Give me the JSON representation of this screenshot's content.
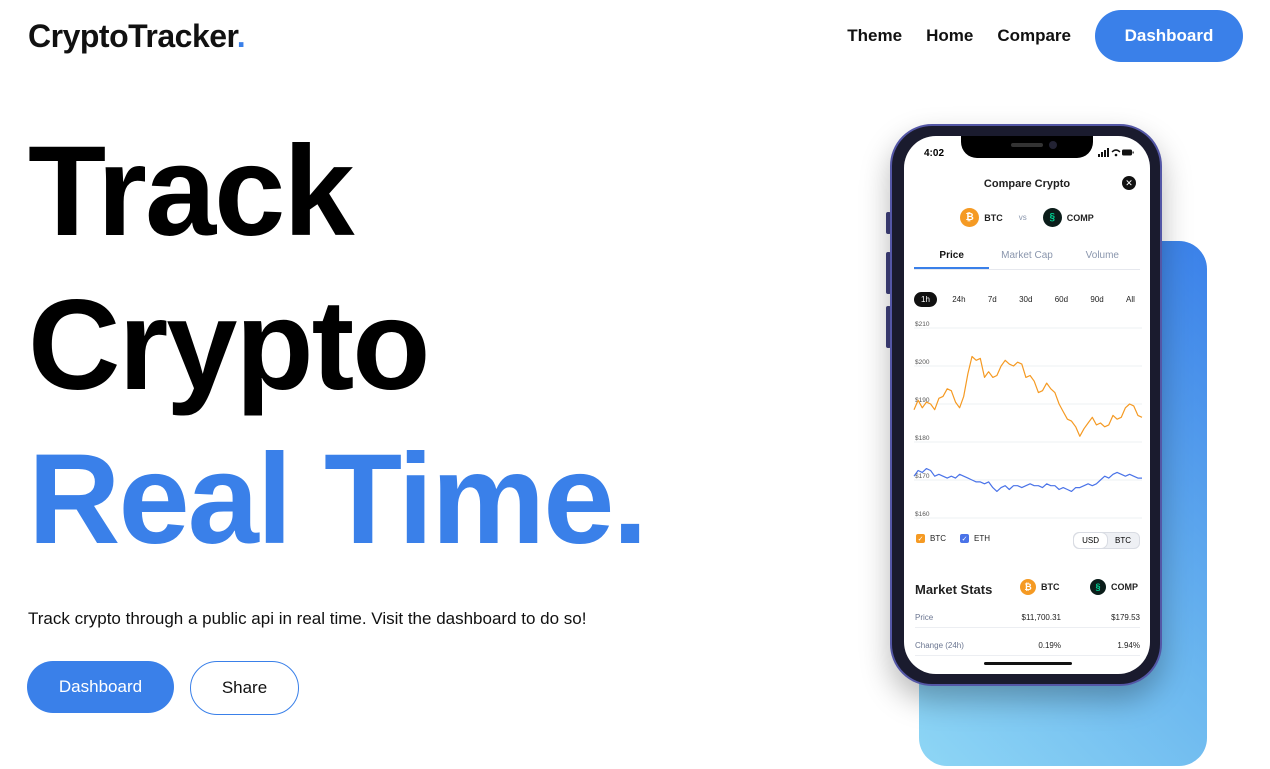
{
  "logo": {
    "text": "CryptoTracker",
    "dot": "."
  },
  "nav": {
    "links": [
      "Theme",
      "Home",
      "Compare"
    ],
    "cta": "Dashboard"
  },
  "hero": {
    "line1": "Track",
    "line2": "Crypto",
    "line3": "Real Time.",
    "subtitle": "Track crypto through a public api in real time. Visit the dashboard to do so!",
    "primary_button": "Dashboard",
    "secondary_button": "Share"
  },
  "colors": {
    "accent": "#3a80e9",
    "btc": "#f59a23",
    "eth_line": "#4a73e8"
  },
  "phone": {
    "time": "4:02",
    "title": "Compare Crypto",
    "coin_a": "BTC",
    "vs": "vs",
    "coin_b": "COMP",
    "tabs": [
      "Price",
      "Market Cap",
      "Volume"
    ],
    "active_tab": "Price",
    "ranges": [
      "1h",
      "24h",
      "7d",
      "30d",
      "60d",
      "90d",
      "All"
    ],
    "active_range": "1h",
    "currency": [
      "USD",
      "BTC"
    ],
    "legend": [
      "BTC",
      "ETH"
    ],
    "stats_title": "Market Stats",
    "stats_rows": [
      {
        "label": "Price",
        "a": "$11,700.31",
        "b": "$179.53"
      },
      {
        "label": "Change (24h)",
        "a": "0.19%",
        "b": "1.94%"
      }
    ]
  },
  "chart_data": {
    "type": "line",
    "y_ticks": [
      "$210",
      "$200",
      "$190",
      "$180",
      "$170",
      "$160"
    ],
    "ylim": [
      160,
      210
    ],
    "series": [
      {
        "name": "BTC",
        "color": "#f59a23",
        "values": [
          188.5,
          191,
          189,
          190.5,
          190,
          188.5,
          191.5,
          192,
          194,
          193.5,
          190.5,
          189,
          192,
          198,
          202.5,
          201.5,
          202,
          197,
          198.5,
          197,
          197.5,
          200,
          201.5,
          200.5,
          200,
          201,
          200.5,
          197,
          197.5,
          196,
          193,
          193.5,
          195.5,
          194,
          193,
          190,
          188,
          186,
          185.5,
          184,
          181.5,
          183.5,
          185,
          186.5,
          184.5,
          185,
          184,
          184.5,
          187,
          186,
          186.5,
          189,
          190,
          189.5,
          187,
          186.5
        ]
      },
      {
        "name": "ETH",
        "color": "#4a73e8",
        "values": [
          171,
          172.5,
          172,
          173,
          172.5,
          171,
          171.5,
          171,
          170.5,
          171,
          170.5,
          171.5,
          171,
          170.5,
          170,
          169.5,
          169.5,
          169,
          169.5,
          168,
          167,
          168,
          168.5,
          167.5,
          168.5,
          168.5,
          168,
          168.5,
          169,
          168.5,
          168.5,
          168,
          169,
          168.5,
          168.5,
          167.5,
          168,
          167.5,
          167,
          168,
          168,
          168.5,
          169,
          168.5,
          169,
          170,
          171,
          170.5,
          171.5,
          172,
          171.5,
          171,
          171.5,
          171,
          170.5,
          170.5
        ]
      }
    ]
  }
}
